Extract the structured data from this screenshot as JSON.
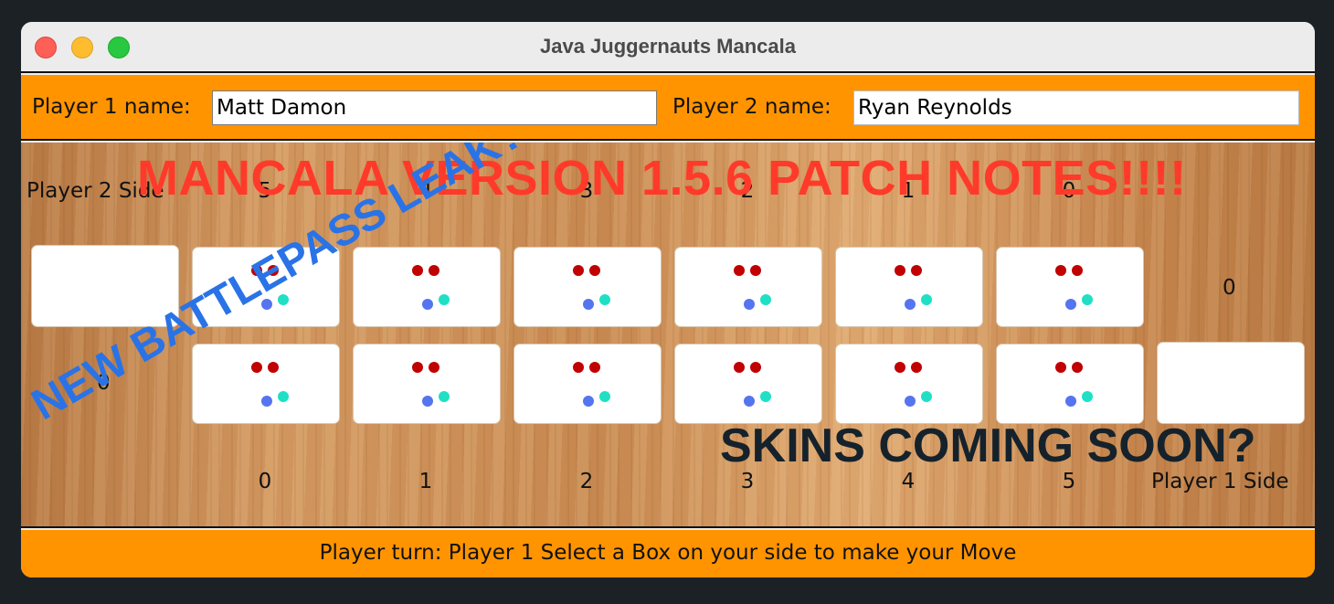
{
  "window": {
    "title": "Java Juggernauts Mancala"
  },
  "names": {
    "p1_label": "Player 1 name:",
    "p1_value": "Matt Damon",
    "p2_label": "Player 2 name:",
    "p2_value": "Ryan Reynolds"
  },
  "board": {
    "player2_side_label": "Player 2 Side",
    "player1_side_label": "Player 1 Side",
    "top_indices": [
      "5",
      "4",
      "3",
      "2",
      "1",
      "0"
    ],
    "bottom_indices": [
      "0",
      "1",
      "2",
      "3",
      "4",
      "5"
    ],
    "player2_store_count": "0",
    "player1_store_count": "0",
    "stones_per_pit": 4,
    "stone_colors": {
      "red": "#c10000",
      "blue": "#5574f0",
      "teal": "#1fe0c4"
    }
  },
  "overlays": {
    "patch_notes": "MANCALA VERSION 1.5.6 PATCH NOTES!!!!",
    "battlepass": "NEW BATTLEPASS LEAK?",
    "skins": "SKINS COMING SOON?"
  },
  "status": {
    "text": "Player turn: Player 1 Select a Box on your side to make your Move"
  },
  "colors": {
    "accent": "#ff9400",
    "board_wood": "#d49a62"
  }
}
